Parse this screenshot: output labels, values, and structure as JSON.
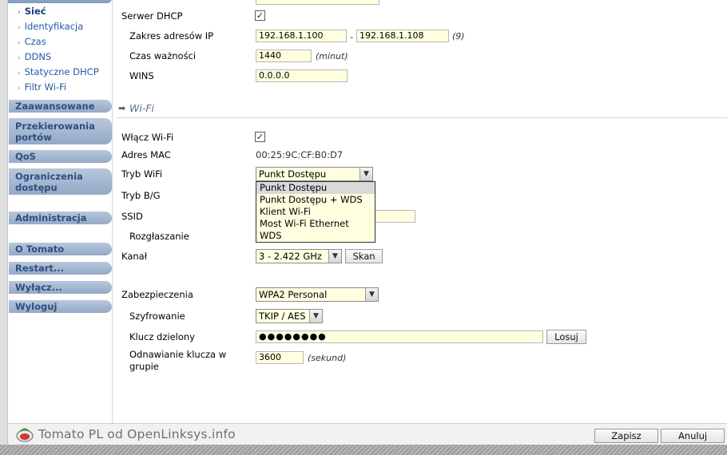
{
  "sidebar": {
    "sub_items": [
      "Sieć",
      "Identyfikacja",
      "Czas",
      "DDNS",
      "Statyczne DHCP",
      "Filtr Wi-Fi"
    ],
    "menu": [
      "Zaawansowane",
      "Przekierowania portów",
      "QoS",
      "Ograniczenia dostępu",
      "Administracja",
      "O Tomato",
      "Restart...",
      "Wyłącz...",
      "Wyloguj"
    ]
  },
  "dhcp": {
    "server_label": "Serwer DHCP",
    "range_label": "Zakres adresów IP",
    "range_start": "192.168.1.100",
    "range_sep": "-",
    "range_end": "192.168.1.108",
    "range_count": "(9)",
    "lease_label": "Czas ważności",
    "lease_value": "1440",
    "lease_unit": "(minut)",
    "wins_label": "WINS",
    "wins_value": "0.0.0.0"
  },
  "wifi": {
    "section_title": "Wi-Fi",
    "enable_label": "Włącz Wi-Fi",
    "mac_label": "Adres MAC",
    "mac_value": "00:25:9C:CF:B0:D7",
    "mode_label": "Tryb WiFi",
    "mode_value": "Punkt Dostępu",
    "mode_options": [
      "Punkt Dostępu",
      "Punkt Dostępu + WDS",
      "Klient Wi-Fi",
      "Most Wi-Fi Ethernet",
      "WDS"
    ],
    "bg_label": "Tryb B/G",
    "ssid_label": "SSID",
    "broadcast_label": "Rozgłaszanie",
    "channel_label": "Kanał",
    "channel_value": "3 - 2.422 GHz",
    "scan_label": "Skan",
    "security_label": "Zabezpieczenia",
    "security_value": "WPA2 Personal",
    "encryption_label": "Szyfrowanie",
    "encryption_value": "TKIP / AES",
    "key_label": "Klucz dzielony",
    "key_value": "●●●●●●●●",
    "random_label": "Losuj",
    "renew_label": "Odnawianie klucza w grupie",
    "renew_value": "3600",
    "renew_unit": "(sekund)"
  },
  "footer": {
    "brand": "Tomato PL od OpenLinksys.info",
    "save": "Zapisz",
    "cancel": "Anuluj"
  },
  "colors": {
    "input_bg": "#ffffe0",
    "menu_bg": "#a6b9d2",
    "link": "#2358a8"
  }
}
